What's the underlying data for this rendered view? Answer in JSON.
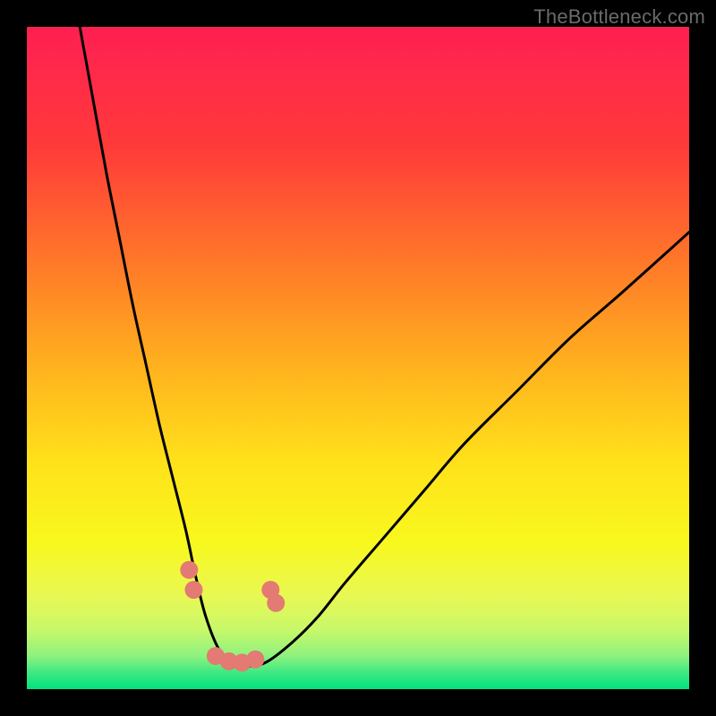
{
  "watermark": "TheBottleneck.com",
  "chart_data": {
    "type": "line",
    "title": "",
    "xlabel": "",
    "ylabel": "",
    "xlim": [
      0,
      100
    ],
    "ylim": [
      0,
      100
    ],
    "series": [
      {
        "name": "curve",
        "x": [
          8,
          10,
          12,
          14,
          16,
          18,
          20,
          22,
          24,
          25.5,
          27,
          29,
          31,
          33,
          36,
          40,
          44,
          48,
          54,
          60,
          66,
          74,
          82,
          90,
          100
        ],
        "values": [
          100,
          89,
          78,
          68,
          58,
          49,
          40,
          32,
          24,
          17,
          11,
          6,
          4,
          3.5,
          4,
          7,
          11,
          16,
          23,
          30,
          37,
          45,
          53,
          60,
          69
        ]
      }
    ],
    "annotations": [
      {
        "name": "valley-marker-left-top",
        "x": 24.5,
        "y": 18
      },
      {
        "name": "valley-marker-left-mid",
        "x": 25.2,
        "y": 15
      },
      {
        "name": "valley-marker-right-top",
        "x": 36.8,
        "y": 15
      },
      {
        "name": "valley-marker-right-mid",
        "x": 37.6,
        "y": 13
      },
      {
        "name": "valley-marker-bottom-1",
        "x": 28.5,
        "y": 5
      },
      {
        "name": "valley-marker-bottom-2",
        "x": 30.5,
        "y": 4.2
      },
      {
        "name": "valley-marker-bottom-3",
        "x": 32.5,
        "y": 4.0
      },
      {
        "name": "valley-marker-bottom-4",
        "x": 34.5,
        "y": 4.5
      }
    ],
    "gradient_stops": [
      {
        "offset": 0.0,
        "color": "#ff1f52"
      },
      {
        "offset": 0.18,
        "color": "#ff3a3a"
      },
      {
        "offset": 0.36,
        "color": "#ff7a28"
      },
      {
        "offset": 0.52,
        "color": "#ffb41e"
      },
      {
        "offset": 0.66,
        "color": "#ffe21a"
      },
      {
        "offset": 0.78,
        "color": "#f8f81e"
      },
      {
        "offset": 0.86,
        "color": "#e8f854"
      },
      {
        "offset": 0.91,
        "color": "#c8f86a"
      },
      {
        "offset": 0.95,
        "color": "#8ef27e"
      },
      {
        "offset": 0.975,
        "color": "#3fe882"
      },
      {
        "offset": 1.0,
        "color": "#00e27e"
      }
    ],
    "marker_color": "#e37a73",
    "curve_color": "#000000"
  }
}
